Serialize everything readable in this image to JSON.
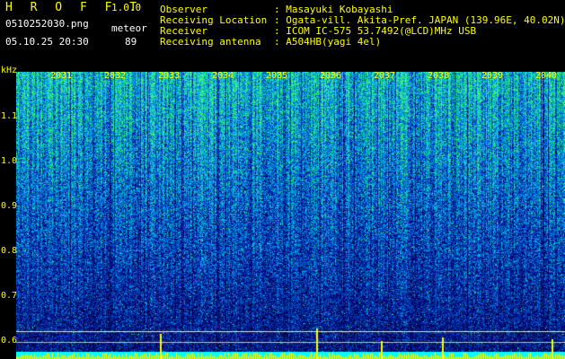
{
  "header": {
    "app_title": "H R O F F T",
    "app_version": "1.0.0",
    "filename": "0510252030.png",
    "mode": "meteor",
    "datetime": "05.10.25 20:30",
    "count": "89",
    "info": [
      {
        "label": "Observer",
        "value": ": Masayuki Kobayashi"
      },
      {
        "label": "Receiving Location",
        "value": ": Ogata-vill. Akita-Pref. JAPAN (139.96E, 40.02N)"
      },
      {
        "label": "Receiver",
        "value": ": ICOM IC-575 53.7492(@LCD)MHz USB"
      },
      {
        "label": "Receiving antenna",
        "value": ": A504HB(yagi 4el)"
      }
    ]
  },
  "y_axis": {
    "unit": "kHz",
    "ticks": [
      "1.1",
      "1.0",
      "0.9",
      "0.8",
      "0.7",
      "0.6"
    ]
  },
  "x_axis": {
    "ticks": [
      "2031",
      "2032",
      "2033",
      "2034",
      "2035",
      "2036",
      "2037",
      "2038",
      "2039",
      "2040"
    ]
  },
  "colors": {
    "background": "#000000",
    "text_primary": "#ffff00",
    "text_secondary": "#ffffff",
    "spectrogram_low": "#00008b",
    "spectrogram_mid": "#1e5aff",
    "spectrogram_high": "#00ff80",
    "baseline_bars": "#00ffff",
    "spikes": "#ffff00"
  }
}
